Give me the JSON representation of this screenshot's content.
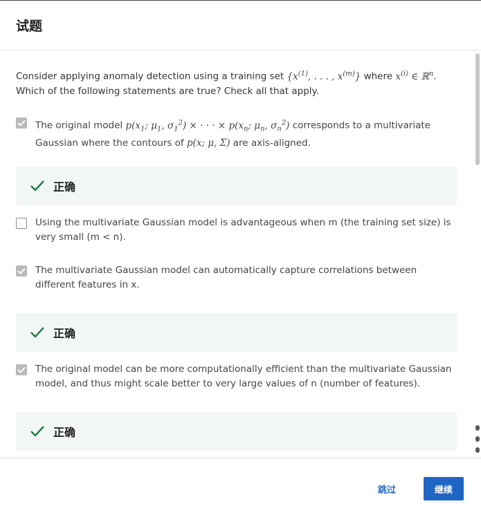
{
  "header": {
    "title": "试题"
  },
  "question": {
    "text_before": "Consider applying anomaly detection using a training set ",
    "math_set": "{x(1), ..., x(m)}",
    "text_where": " where ",
    "math_member": "x(i) ∈ ℝn",
    "text_after": ". Which of the following statements are true? Check all that apply."
  },
  "options": [
    {
      "checked": true,
      "text_a": "The original model ",
      "math_a": "p(x1; μ1, σ1²) × ··· × p(xn; μn, σn²)",
      "text_b": " corresponds to a multivariate Gaussian where the contours of ",
      "math_b": "p(x; μ, Σ)",
      "text_c": " are axis-aligned.",
      "feedback": "正确"
    },
    {
      "checked": false,
      "text": "Using the multivariate Gaussian model is advantageous when m (the training set size) is very small (m < n)."
    },
    {
      "checked": true,
      "text": "The multivariate Gaussian model can automatically capture correlations between different features in x.",
      "feedback": "正确"
    },
    {
      "checked": true,
      "text": "The original model can be more computationally efficient than the multivariate Gaussian model, and thus might scale better to very large values of n (number of features).",
      "feedback": "正确"
    }
  ],
  "footer": {
    "skip_label": "跳过",
    "continue_label": "继续"
  },
  "colors": {
    "primary": "#1f66c4",
    "correct_check": "#1e7a46",
    "feedback_bg": "#f2f7f5"
  }
}
